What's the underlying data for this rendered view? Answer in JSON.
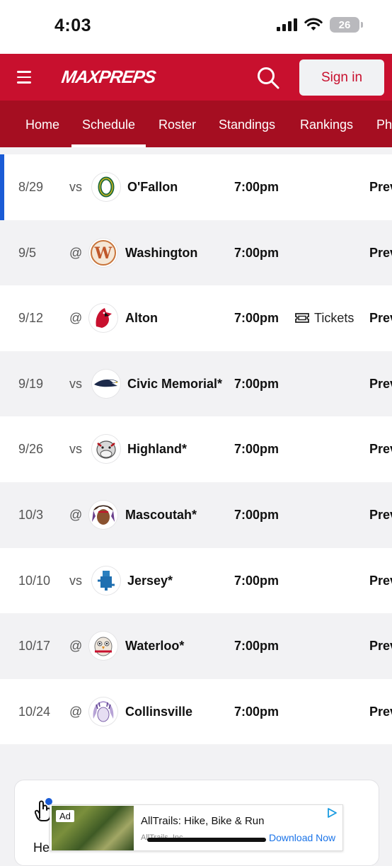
{
  "status_bar": {
    "time": "4:03",
    "battery": "26"
  },
  "header": {
    "logo_text": "MAXPREPS",
    "sign_in_label": "Sign in"
  },
  "tabs": [
    {
      "label": "Home"
    },
    {
      "label": "Schedule",
      "active": true
    },
    {
      "label": "Roster"
    },
    {
      "label": "Standings"
    },
    {
      "label": "Rankings"
    },
    {
      "label": "Ph"
    }
  ],
  "schedule": [
    {
      "date": "8/29",
      "home_away": "vs",
      "opponent": "O'Fallon",
      "time": "7:00pm",
      "tickets": "",
      "preview": "Prev",
      "logo": "ofallon-logo"
    },
    {
      "date": "9/5",
      "home_away": "@",
      "opponent": "Washington",
      "time": "7:00pm",
      "tickets": "",
      "preview": "Prev",
      "logo": "washington-logo"
    },
    {
      "date": "9/12",
      "home_away": "@",
      "opponent": "Alton",
      "time": "7:00pm",
      "tickets": "Tickets",
      "preview": "Prev",
      "logo": "alton-logo"
    },
    {
      "date": "9/19",
      "home_away": "vs",
      "opponent": "Civic Memorial*",
      "time": "7:00pm",
      "tickets": "",
      "preview": "Prev",
      "logo": "civic-memorial-logo"
    },
    {
      "date": "9/26",
      "home_away": "vs",
      "opponent": "Highland*",
      "time": "7:00pm",
      "tickets": "",
      "preview": "Prev",
      "logo": "highland-logo"
    },
    {
      "date": "10/3",
      "home_away": "@",
      "opponent": "Mascoutah*",
      "time": "7:00pm",
      "tickets": "",
      "preview": "Prev",
      "logo": "mascoutah-logo"
    },
    {
      "date": "10/10",
      "home_away": "vs",
      "opponent": "Jersey*",
      "time": "7:00pm",
      "tickets": "",
      "preview": "Prev",
      "logo": "jersey-logo"
    },
    {
      "date": "10/17",
      "home_away": "@",
      "opponent": "Waterloo*",
      "time": "7:00pm",
      "tickets": "",
      "preview": "Prev",
      "logo": "waterloo-logo"
    },
    {
      "date": "10/24",
      "home_away": "@",
      "opponent": "Collinsville",
      "time": "7:00pm",
      "tickets": "",
      "preview": "Prev",
      "logo": "collinsville-logo"
    }
  ],
  "card": {
    "partial_text": "He"
  },
  "ad": {
    "badge": "Ad",
    "title": "AllTrails: Hike, Bike & Run",
    "advertiser": "AllTrails, Inc.",
    "cta": "Download Now"
  },
  "colors": {
    "brand_red": "#c8102e",
    "tab_bar": "#a50e21",
    "accent_blue": "#1a5bd6"
  }
}
